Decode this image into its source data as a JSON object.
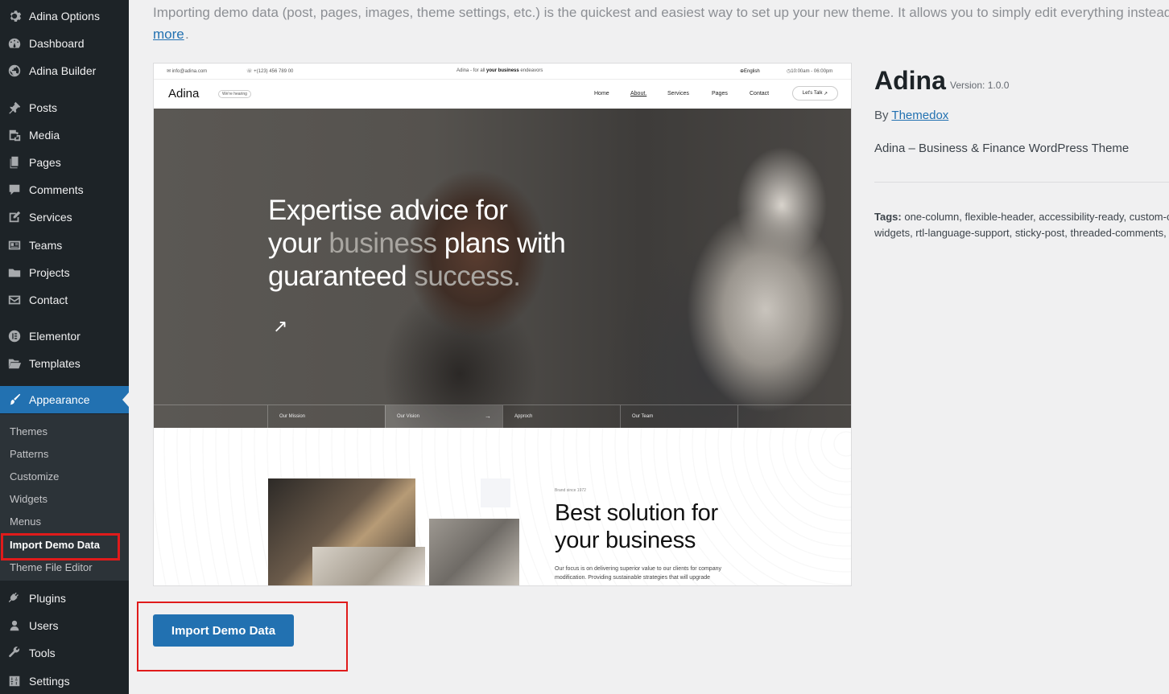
{
  "sidebar": {
    "items": [
      {
        "label": "Adina Options",
        "icon": "gear-icon"
      },
      {
        "label": "Dashboard",
        "icon": "dashboard-icon"
      },
      {
        "label": "Adina Builder",
        "icon": "globe-icon"
      },
      {
        "label": "Posts",
        "icon": "pin-icon"
      },
      {
        "label": "Media",
        "icon": "media-icon"
      },
      {
        "label": "Pages",
        "icon": "pages-icon"
      },
      {
        "label": "Comments",
        "icon": "comment-icon"
      },
      {
        "label": "Services",
        "icon": "edit-icon"
      },
      {
        "label": "Teams",
        "icon": "id-card-icon"
      },
      {
        "label": "Projects",
        "icon": "folder-icon"
      },
      {
        "label": "Contact",
        "icon": "mail-icon"
      },
      {
        "label": "Elementor",
        "icon": "elementor-icon"
      },
      {
        "label": "Templates",
        "icon": "folder-open-icon"
      },
      {
        "label": "Appearance",
        "icon": "brush-icon"
      },
      {
        "label": "Plugins",
        "icon": "plugin-icon"
      },
      {
        "label": "Users",
        "icon": "user-icon"
      },
      {
        "label": "Tools",
        "icon": "wrench-icon"
      },
      {
        "label": "Settings",
        "icon": "settings-icon"
      }
    ],
    "submenu": [
      "Themes",
      "Patterns",
      "Customize",
      "Widgets",
      "Menus",
      "Import Demo Data",
      "Theme File Editor"
    ],
    "current_submenu": "Import Demo Data",
    "accent": "#2271b1"
  },
  "intro": {
    "text": "Importing demo data (post, pages, images, theme settings, etc.) is the quickest and easiest way to set up your new theme. It allows you to simply edit everything instead",
    "more_link": "more",
    "tail": "."
  },
  "preview": {
    "topbar": {
      "email": "info@adina.com",
      "phone": "+(123) 456 789 00",
      "tagline_pre": "Adina - for all",
      "tagline_bold": "your business",
      "tagline_post": "endeavors",
      "language": "English",
      "hours": "10:00am - 06:00pm"
    },
    "nav": {
      "brand": "Adina",
      "badge": "We're hearing",
      "links": [
        "Home",
        "About.",
        "Services",
        "Pages",
        "Contact"
      ],
      "cta": "Let's Talk"
    },
    "hero": {
      "line1": "Expertise advice for",
      "line2_a": "your",
      "line2_dim": "business",
      "line2_b": "plans with",
      "line3_a": "guaranteed",
      "line3_dim": "success.",
      "arrow": "↗",
      "tabs": [
        "Our Mission",
        "Our Vision",
        "Approch",
        "Our Team"
      ],
      "tab_arrow": "→"
    },
    "section2": {
      "small": "Brand since 1972",
      "title_line1": "Best solution for",
      "title_line2": "your business",
      "text": "Our focus is on delivering superior value to our clients for company modification. Providing sustainable strategies that will upgrade"
    }
  },
  "theme": {
    "name": "Adina",
    "version": "Version: 1.0.0",
    "by_prefix": "By",
    "author": "Themedox",
    "description": "Adina – Business & Finance WordPress Theme",
    "tags_label": "Tags:",
    "tags_line1": "one-column, flexible-header, accessibility-ready, custom-c",
    "tags_line2": "widgets, rtl-language-support, sticky-post, threaded-comments,"
  },
  "import_button": "Import Demo Data"
}
